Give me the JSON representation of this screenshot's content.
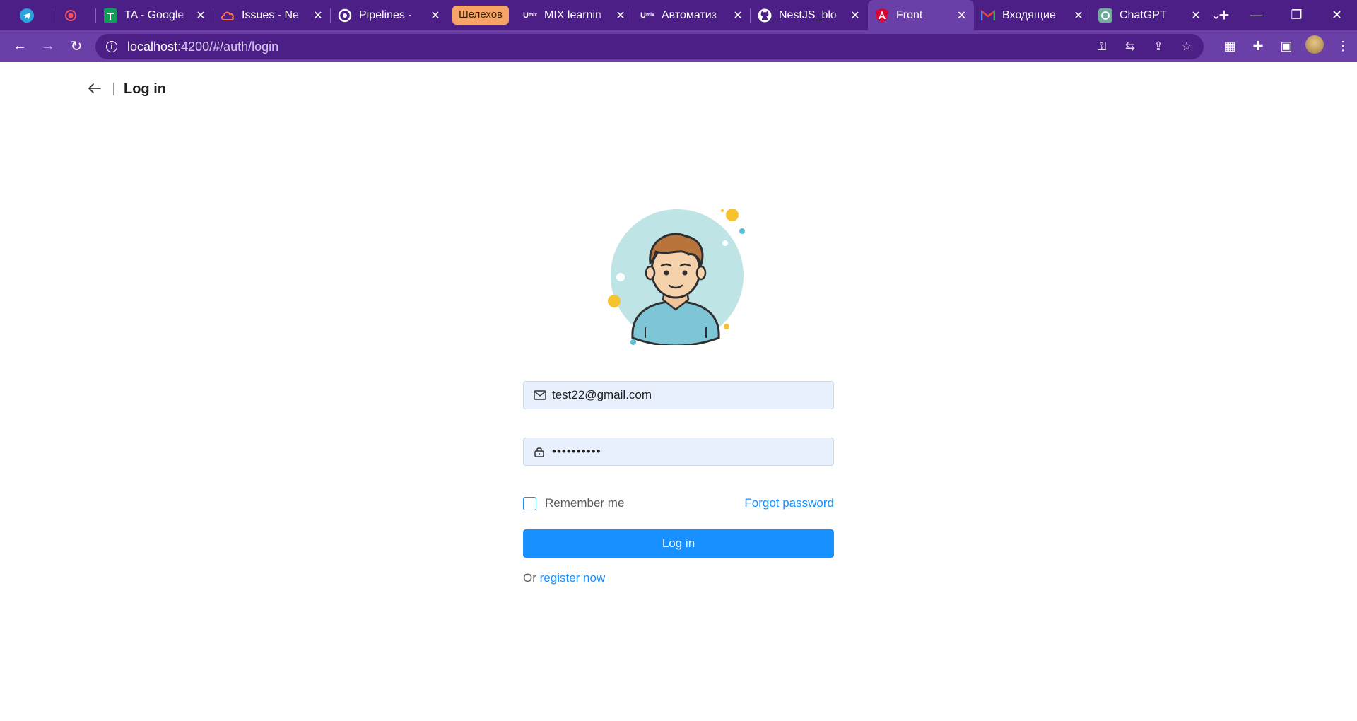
{
  "browser": {
    "tabs": [
      {
        "label": "",
        "icon": "telegram-icon",
        "color": "#2aa3de"
      },
      {
        "label": "",
        "icon": "record-icon",
        "color": "#f2556b"
      },
      {
        "label": "TA - Google",
        "icon": "sheets-icon",
        "color": "#0f9d58"
      },
      {
        "label": "Issues - Ne",
        "icon": "cloud-icon",
        "color": "#ff7043"
      },
      {
        "label": "Pipelines -",
        "icon": "pipeline-icon",
        "color": "#ffffff"
      },
      {
        "label": "MIX learnin",
        "icon": "mix-icon",
        "color": "#ffffff"
      },
      {
        "label": "Автоматиз",
        "icon": "mix-icon",
        "color": "#ffffff"
      },
      {
        "label": "NestJS_blo",
        "icon": "github-icon",
        "color": "#ffffff"
      },
      {
        "label": "Front",
        "icon": "angular-icon",
        "color": "#dd0031"
      },
      {
        "label": "Входящие",
        "icon": "gmail-icon",
        "color": "#ea4335"
      },
      {
        "label": "ChatGPT",
        "icon": "chatgpt-icon",
        "color": "#74aa9c"
      }
    ],
    "tab_group_label": "Шелехов",
    "url_host": "localhost",
    "url_path": ":4200/#/auth/login"
  },
  "page": {
    "header_title": "Log in",
    "email_value": "test22@gmail.com",
    "password_value": "••••••••••",
    "remember_label": "Remember me",
    "forgot_label": "Forgot password",
    "login_button_label": "Log in",
    "register_prefix": "Or",
    "register_link": "register now"
  },
  "colors": {
    "tabstrip": "#4b1f86",
    "toolbar": "#6b3fa8",
    "primary": "#1890ff",
    "input_bg": "#e8f0fe"
  }
}
